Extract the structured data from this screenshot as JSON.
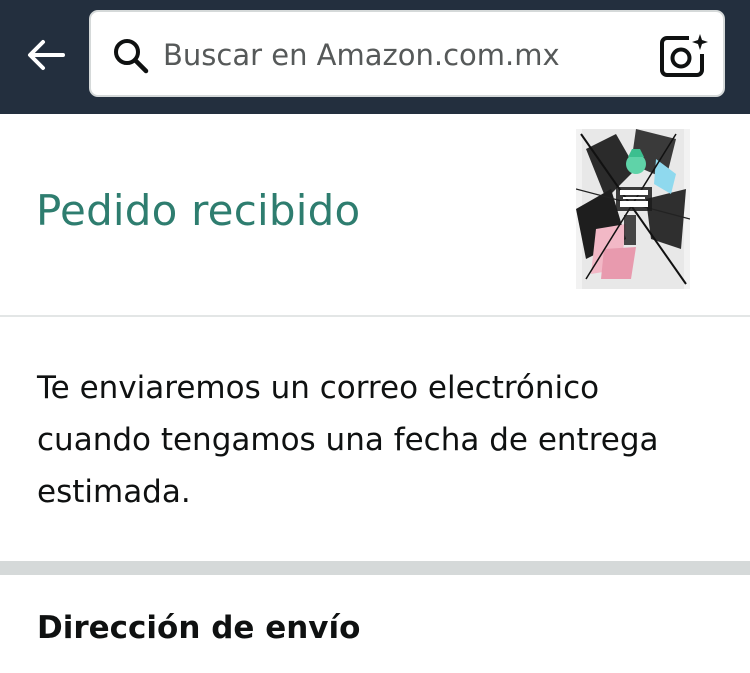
{
  "header": {
    "back_icon": "arrow-left-icon",
    "search_placeholder": "Buscar en Amazon.com.mx",
    "search_icon": "search-icon",
    "camera_icon": "camera-scan-icon"
  },
  "order_status": {
    "title": "Pedido recibido",
    "product_image_alt": "La Tierra de las Gemas - Haruko Ichikawa"
  },
  "message": {
    "text": "Te enviaremos un correo electrónico cuando tengamos una fecha de entrega estimada."
  },
  "shipping": {
    "heading": "Dirección de envío"
  },
  "colors": {
    "header_bg": "#232f3e",
    "status_green": "#2e7d6f",
    "divider": "#e3e6e6",
    "band": "#d5d9d9"
  }
}
